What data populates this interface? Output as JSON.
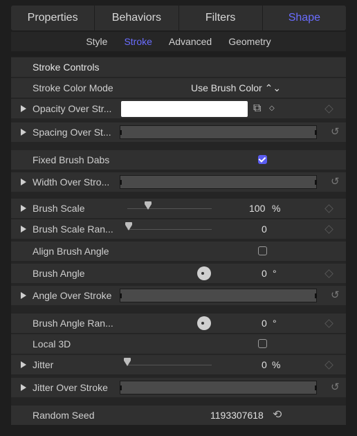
{
  "tabs": [
    "Properties",
    "Behaviors",
    "Filters",
    "Shape"
  ],
  "subtabs": [
    "Style",
    "Stroke",
    "Advanced",
    "Geometry"
  ],
  "section_title": "Stroke Controls",
  "rows": {
    "stroke_color_mode": {
      "label": "Stroke Color Mode",
      "value": "Use Brush Color ⌃⌄"
    },
    "opacity": {
      "label": "Opacity Over Str...",
      "color": "#ffffff"
    },
    "spacing": {
      "label": "Spacing Over St..."
    },
    "fixed_dabs": {
      "label": "Fixed Brush Dabs",
      "checked": true
    },
    "width": {
      "label": "Width Over Stro..."
    },
    "brush_scale": {
      "label": "Brush Scale",
      "value": "100",
      "unit": "%"
    },
    "brush_scale_range": {
      "label": "Brush Scale Ran...",
      "value": "0"
    },
    "align_angle": {
      "label": "Align Brush Angle",
      "checked": false
    },
    "brush_angle": {
      "label": "Brush Angle",
      "value": "0",
      "unit": "°"
    },
    "angle_over": {
      "label": "Angle Over Stroke"
    },
    "brush_angle_range": {
      "label": "Brush Angle Ran...",
      "value": "0",
      "unit": "°"
    },
    "local3d": {
      "label": "Local 3D",
      "checked": false
    },
    "jitter": {
      "label": "Jitter",
      "value": "0",
      "unit": "%"
    },
    "jitter_over": {
      "label": "Jitter Over Stroke"
    },
    "random_seed": {
      "label": "Random Seed",
      "value": "1193307618"
    }
  },
  "icons": {
    "reset": "reset-icon",
    "keyframe": "keyframe-diamond-icon",
    "regen": "regenerate-icon"
  }
}
